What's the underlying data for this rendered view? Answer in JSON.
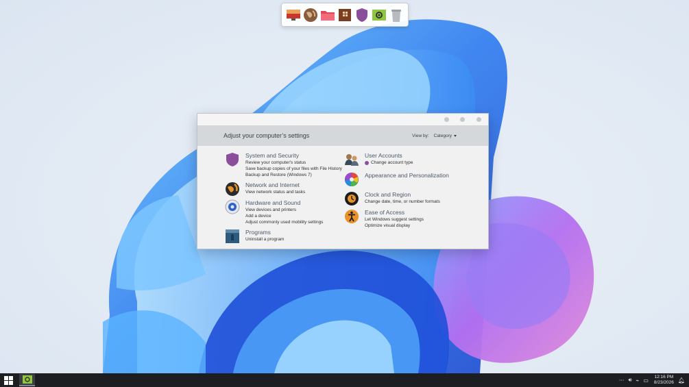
{
  "dock": {
    "items": [
      "display-icon",
      "globe-icon",
      "folder-icon",
      "package-icon",
      "shield-icon",
      "settings-icon",
      "trash-icon"
    ]
  },
  "window": {
    "header_title": "Adjust your computer’s settings",
    "view_by_label": "View by:",
    "view_by_value": "Category",
    "categories": {
      "system": {
        "title": "System and Security",
        "links": [
          "Review your computer's status",
          "Save backup copies of your files with File History",
          "Backup and Restore (Windows 7)"
        ]
      },
      "network": {
        "title": "Network and Internet",
        "links": [
          "View network status and tasks"
        ]
      },
      "hardware": {
        "title": "Hardware and Sound",
        "links": [
          "View devices and printers",
          "Add a device",
          "Adjust commonly used mobility settings"
        ]
      },
      "programs": {
        "title": "Programs",
        "links": [
          "Uninstall a program"
        ]
      },
      "users": {
        "title": "User Accounts",
        "links": [
          "Change account type"
        ]
      },
      "appearance": {
        "title": "Appearance and Personalization",
        "links": []
      },
      "clock": {
        "title": "Clock and Region",
        "links": [
          "Change date, time, or number formats"
        ]
      },
      "ease": {
        "title": "Ease of Access",
        "links": [
          "Let Windows suggest settings",
          "Optimize visual display"
        ]
      }
    }
  },
  "taskbar": {
    "time": "12:16 PM",
    "date": "8/23/2026"
  },
  "colors": {
    "shield": "#8b4e9a",
    "taskbar": "#1c1e22",
    "header": "#d4d8da"
  }
}
